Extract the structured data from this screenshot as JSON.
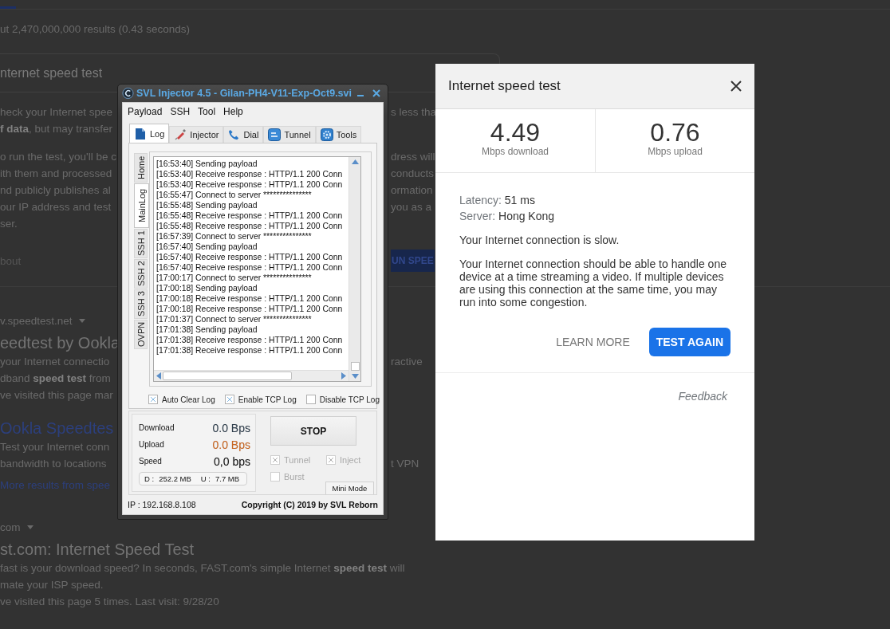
{
  "search_page": {
    "sections": [
      {
        "lines": [
          {
            "kind": "stats",
            "left": "ut 2,470,000,000 results (0.43 seconds)"
          }
        ]
      },
      {
        "lines": [
          {
            "kind": "query",
            "left": "nternet speed test"
          }
        ]
      },
      {
        "lines": [
          {
            "kind": "text",
            "left": "heck your Internet spee",
            "right": "s less tha"
          },
          {
            "kind": "text",
            "left": "**f data**, but may transfer"
          }
        ]
      },
      {
        "lines": [
          {
            "kind": "text",
            "left": "o run the test, you'll be c",
            "right": "dress will"
          },
          {
            "kind": "text",
            "left": "ith them and processed",
            "right": "conducts"
          },
          {
            "kind": "text",
            "left": "nd publicly publishes al",
            "right": "ormation"
          },
          {
            "kind": "text",
            "left": "our IP address and test",
            "right": "you as a"
          },
          {
            "kind": "text",
            "left": "ser."
          }
        ]
      },
      {
        "lines": [
          {
            "kind": "about",
            "left": "bout",
            "right": "UN SPEE"
          }
        ]
      },
      {
        "lines": [
          {
            "kind": "url",
            "left": "v.speedtest.net"
          },
          {
            "kind": "title",
            "left": "eedtest by Ookla"
          },
          {
            "kind": "text",
            "left": "your Internet connectio",
            "right": "ractive"
          },
          {
            "kind": "text",
            "left": "dband **speed test** from"
          },
          {
            "kind": "text",
            "left": "ve visited this page mar"
          }
        ]
      },
      {
        "lines": [
          {
            "kind": "link-title",
            "left": "Ookla Speedtes"
          },
          {
            "kind": "text",
            "left": "Test your Internet conn"
          },
          {
            "kind": "text",
            "left": "bandwidth to locations",
            "right": "t VPN"
          },
          {
            "kind": "more",
            "left": "More results from spee"
          }
        ]
      },
      {
        "lines": [
          {
            "kind": "url",
            "left": "com"
          },
          {
            "kind": "title",
            "left": "st.com: Internet Speed Test"
          },
          {
            "kind": "text",
            "left": "fast is your download speed? In seconds, FAST.com's simple Internet **speed test** will"
          },
          {
            "kind": "text",
            "left": "mate your ISP speed."
          },
          {
            "kind": "text",
            "left": "ve visited this page 5 times. Last visit: 9/28/20"
          }
        ]
      }
    ]
  },
  "injector": {
    "title": "SVL Injector 4.5 - Gilan-PH4-V11-Exp-Oct9.svi",
    "menu": [
      "Payload",
      "SSH",
      "Tool",
      "Help"
    ],
    "tabs": [
      {
        "label": "Log",
        "selected": true
      },
      {
        "label": "Injector",
        "selected": false
      },
      {
        "label": "Dial",
        "selected": false
      },
      {
        "label": "Tunnel",
        "selected": false
      },
      {
        "label": "Tools",
        "selected": false
      }
    ],
    "side_tabs": [
      {
        "label": "Home",
        "selected": false
      },
      {
        "label": "MainLog",
        "selected": true
      },
      {
        "label": "SSH 1",
        "selected": false
      },
      {
        "label": "SSH 2",
        "selected": false
      },
      {
        "label": "SSH 3",
        "selected": false
      },
      {
        "label": "OVPN",
        "selected": false
      }
    ],
    "log": [
      "[16:53:40] Sending payload",
      "[16:53:40] Receive response : HTTP/1.1 200 Conn",
      "[16:53:40] Receive response : HTTP/1.1 200 Conn",
      "[16:55:47] Connect to server ***************",
      "[16:55:48] Sending payload",
      "[16:55:48] Receive response : HTTP/1.1 200 Conn",
      "[16:55:48] Receive response : HTTP/1.1 200 Conn",
      "[16:57:39] Connect to server ***************",
      "[16:57:40] Sending payload",
      "[16:57:40] Receive response : HTTP/1.1 200 Conn",
      "[16:57:40] Receive response : HTTP/1.1 200 Conn",
      "[17:00:17] Connect to server ***************",
      "[17:00:18] Sending payload",
      "[17:00:18] Receive response : HTTP/1.1 200 Conn",
      "[17:00:18] Receive response : HTTP/1.1 200 Conn",
      "[17:01:37] Connect to server ***************",
      "[17:01:38] Sending payload",
      "[17:01:38] Receive response : HTTP/1.1 200 Conn",
      "[17:01:38] Receive response : HTTP/1.1 200 Conn"
    ],
    "log_options": [
      {
        "label": "Auto Clear Log",
        "checked": true
      },
      {
        "label": "Enable TCP Log",
        "checked": true
      },
      {
        "label": "Disable TCP Log",
        "checked": false
      }
    ],
    "stats": [
      {
        "label": "Download",
        "value": "0.0 Bps",
        "color": "#2f3e4c"
      },
      {
        "label": "Upload",
        "value": "0.0 Bps",
        "color": "#c8641e"
      },
      {
        "label": "Speed",
        "value": "0,0 bps",
        "color": "#111111"
      }
    ],
    "totals": [
      {
        "label": "D :",
        "value": "252.2 MB"
      },
      {
        "label": "U :",
        "value": "7.7 MB"
      }
    ],
    "stop_button": "STOP",
    "run_options": [
      {
        "label": "Tunnel",
        "checked": true,
        "disabled": true
      },
      {
        "label": "Inject",
        "checked": true,
        "disabled": true
      },
      {
        "label": "Burst",
        "checked": false,
        "disabled": true
      }
    ],
    "mini_mode_button": "Mini Mode",
    "ip": "IP : 192.168.8.108",
    "copyright": "Copyright (C) 2019 by SVL Reborn"
  },
  "speed_dialog": {
    "title": "Internet speed test",
    "results": [
      {
        "value": "4.49",
        "unit": "Mbps download"
      },
      {
        "value": "0.76",
        "unit": "Mbps upload"
      }
    ],
    "details": [
      {
        "label": "Latency:",
        "value": "51 ms"
      },
      {
        "label": "Server:",
        "value": "Hong Kong"
      }
    ],
    "status": "Your Internet connection is slow.",
    "description": "Your Internet connection should be able to handle one device at a time streaming a video. If multiple devices are using this connection at the same time, you may run into some congestion.",
    "buttons": [
      {
        "label": "LEARN MORE",
        "kind": "text"
      },
      {
        "label": "TEST AGAIN",
        "kind": "primary"
      }
    ],
    "feedback": "Feedback"
  }
}
